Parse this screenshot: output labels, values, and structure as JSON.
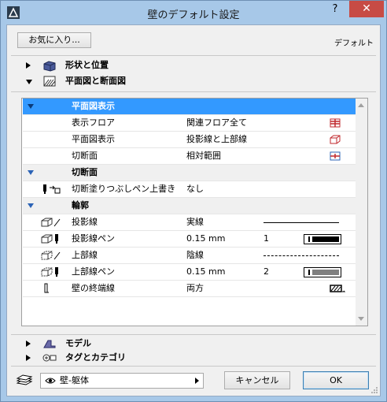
{
  "window": {
    "title": "壁のデフォルト設定",
    "help_label": "?",
    "close_label": "✕"
  },
  "toolbar": {
    "favorites_label": "お気に入り...",
    "default_label": "デフォルト"
  },
  "sections": {
    "shape_position": "形状と位置",
    "plan_section": "平面図と断面図",
    "model": "モデル",
    "tags_categories": "タグとカテゴリ"
  },
  "panel": {
    "groups": {
      "plan_display": "平面図表示",
      "cut_surfaces": "切断面",
      "outlines": "輪郭"
    },
    "rows": [
      {
        "name": "表示フロア",
        "value": "関連フロア全て"
      },
      {
        "name": "平面図表示",
        "value": "投影線と上部線"
      },
      {
        "name": "切断面",
        "value": "相対範囲"
      },
      {
        "name": "切断塗りつぶしペン上書き",
        "value": "なし"
      },
      {
        "name": "投影線",
        "value": "実線"
      },
      {
        "name": "投影線ペン",
        "value": "0.15 mm",
        "pen": "1"
      },
      {
        "name": "上部線",
        "value": "陰線"
      },
      {
        "name": "上部線ペン",
        "value": "0.15 mm",
        "pen": "2"
      },
      {
        "name": "壁の終端線",
        "value": "両方"
      }
    ]
  },
  "footer": {
    "layer_value": "壁-躯体",
    "cancel_label": "キャンセル",
    "ok_label": "OK"
  },
  "colors": {
    "selection": "#3399ff",
    "close_button": "#c74b45",
    "pen_fill_1": "#000000",
    "pen_fill_2": "#808080"
  },
  "icons": {
    "app": "archicad-icon",
    "layer": "layers-icon",
    "eye": "eye-icon"
  }
}
